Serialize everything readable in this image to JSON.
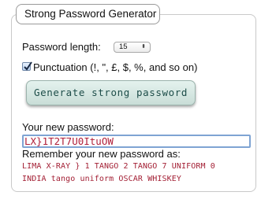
{
  "panel": {
    "title": "Strong Password Generator"
  },
  "length": {
    "label": "Password length:",
    "selected_value": "15"
  },
  "punctuation": {
    "checked": true,
    "label": "Punctuation (!, \", £, $, %, and so on)"
  },
  "generate_button": {
    "label": "Generate strong password"
  },
  "result": {
    "label": "Your new password:",
    "password": "LX}1T2T7U0ItuOW",
    "remember_label": "Remember your new password as:",
    "phonetic_line1": "LIMA X-RAY } 1 TANGO 2 TANGO 7 UNIFORM 0",
    "phonetic_line2": "INDIA tango uniform OSCAR WHISKEY"
  },
  "colors": {
    "accent_text": "#1d4d49",
    "password_red": "#b0203a",
    "focus_border": "#7fa4d3"
  }
}
